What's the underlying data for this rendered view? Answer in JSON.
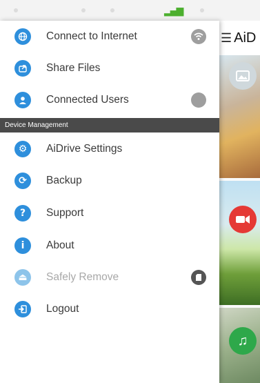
{
  "app": {
    "title": "AiD",
    "tiles": [
      {
        "icon": "image-icon",
        "color": "#cfd8dc"
      },
      {
        "icon": "video-camera-icon",
        "color": "#e53935"
      },
      {
        "icon": "music-note-icon",
        "color": "#2ea84a"
      }
    ]
  },
  "drawer": {
    "items_top": [
      {
        "label": "Connect to Internet",
        "icon": "globe-icon",
        "trail_icon": "wifi-icon"
      },
      {
        "label": "Share Files",
        "icon": "share-icon"
      },
      {
        "label": "Connected Users",
        "icon": "user-icon",
        "trail_icon": "status-dot-icon"
      }
    ],
    "section_title": "Device Management",
    "items_bottom": [
      {
        "label": "AiDrive Settings",
        "icon": "gear-icon"
      },
      {
        "label": "Backup",
        "icon": "sync-icon"
      },
      {
        "label": "Support",
        "icon": "help-icon"
      },
      {
        "label": "About",
        "icon": "info-icon"
      },
      {
        "label": "Safely Remove",
        "icon": "eject-icon",
        "disabled": true,
        "trail_icon": "sd-card-icon"
      },
      {
        "label": "Logout",
        "icon": "logout-icon"
      }
    ]
  }
}
